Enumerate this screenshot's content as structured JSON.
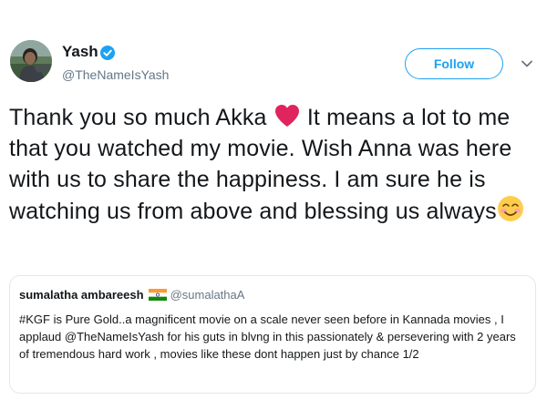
{
  "author": {
    "name": "Yash",
    "handle": "@TheNameIsYash",
    "verified": true,
    "avatar_icon": "profile-photo"
  },
  "follow_button": {
    "label": "Follow",
    "color": "#1da1f2"
  },
  "menu_icon": "chevron-down-icon",
  "tweet": {
    "text_part1": "Thank you so much Akka ",
    "text_part2": " It means a lot to me that you watched my movie. Wish Anna was here with us to share the happiness. I am sure he is watching us from above and blessing us always",
    "emoji_1": "red-heart",
    "emoji_2": "smiling-face-with-smiling-eyes"
  },
  "quoted_tweet": {
    "name": "sumalatha ambareesh",
    "flag_icon": "india-flag-icon",
    "handle": "@sumalathaA",
    "text": "#KGF is Pure Gold..a magnificent movie on a scale never seen before in Kannada movies , I applaud @TheNameIsYash for his guts in blvng in this passionately & persevering with 2 years of tremendous hard work , movies like these dont happen just by chance 1/2"
  },
  "colors": {
    "accent": "#1da1f2",
    "text": "#14171a",
    "secondary_text": "#657786",
    "border": "#e1e8ed"
  }
}
